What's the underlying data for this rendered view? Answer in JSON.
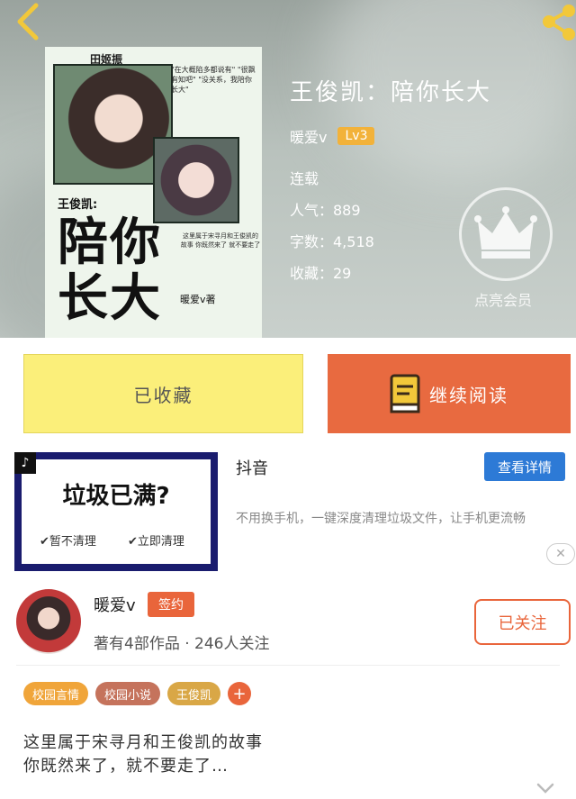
{
  "header": {
    "back_icon": "chevron-left-icon",
    "share_icon": "share-icon"
  },
  "cover": {
    "name_top": "田姬振",
    "quote": "\"在大概陷多都说有\" \"很飘有知吧\" \"没关系，我陪你长大\"",
    "subtitle": "王俊凯:",
    "big_title": "陪你长大",
    "small_text": "这里属于宋寻月和王俊凯的故事 你既然来了 就不要走了",
    "signature": "暖爱v著"
  },
  "book": {
    "title": "王俊凯：陪你长大",
    "author": "暖爱v",
    "level": "Lv3",
    "status": "连载",
    "popularity": "人气：889",
    "word_count": "字数：4,518",
    "favorites": "收藏：29",
    "vip_label": "点亮会员"
  },
  "actions": {
    "favorited_label": "已收藏",
    "read_label": "继续阅读"
  },
  "ad": {
    "question": "垃圾已满?",
    "option_1": "✔暂不清理",
    "option_2": "✔立即清理",
    "brand": "抖音",
    "detail_label": "查看详情",
    "description": "不用换手机，一键深度清理垃圾文件，让手机更流畅",
    "close": "✕"
  },
  "author_card": {
    "name": "暖爱v",
    "badge": "签约",
    "stats": "著有4部作品 · 246人关注",
    "follow_label": "已关注"
  },
  "tags": [
    {
      "label": "校园言情",
      "color": "#f0a53a"
    },
    {
      "label": "校园小说",
      "color": "#c5735c"
    },
    {
      "label": "王俊凯",
      "color": "#d9a746"
    }
  ],
  "tag_add": "+",
  "intro": {
    "line1": "这里属于宋寻月和王俊凯的故事",
    "line2": "你既然来了，就不要走了…"
  },
  "colors": {
    "accent": "#e9653b",
    "fav_bg": "#fbef7a",
    "lv": "#f2b23a",
    "detail_btn": "#2d7ad6"
  }
}
